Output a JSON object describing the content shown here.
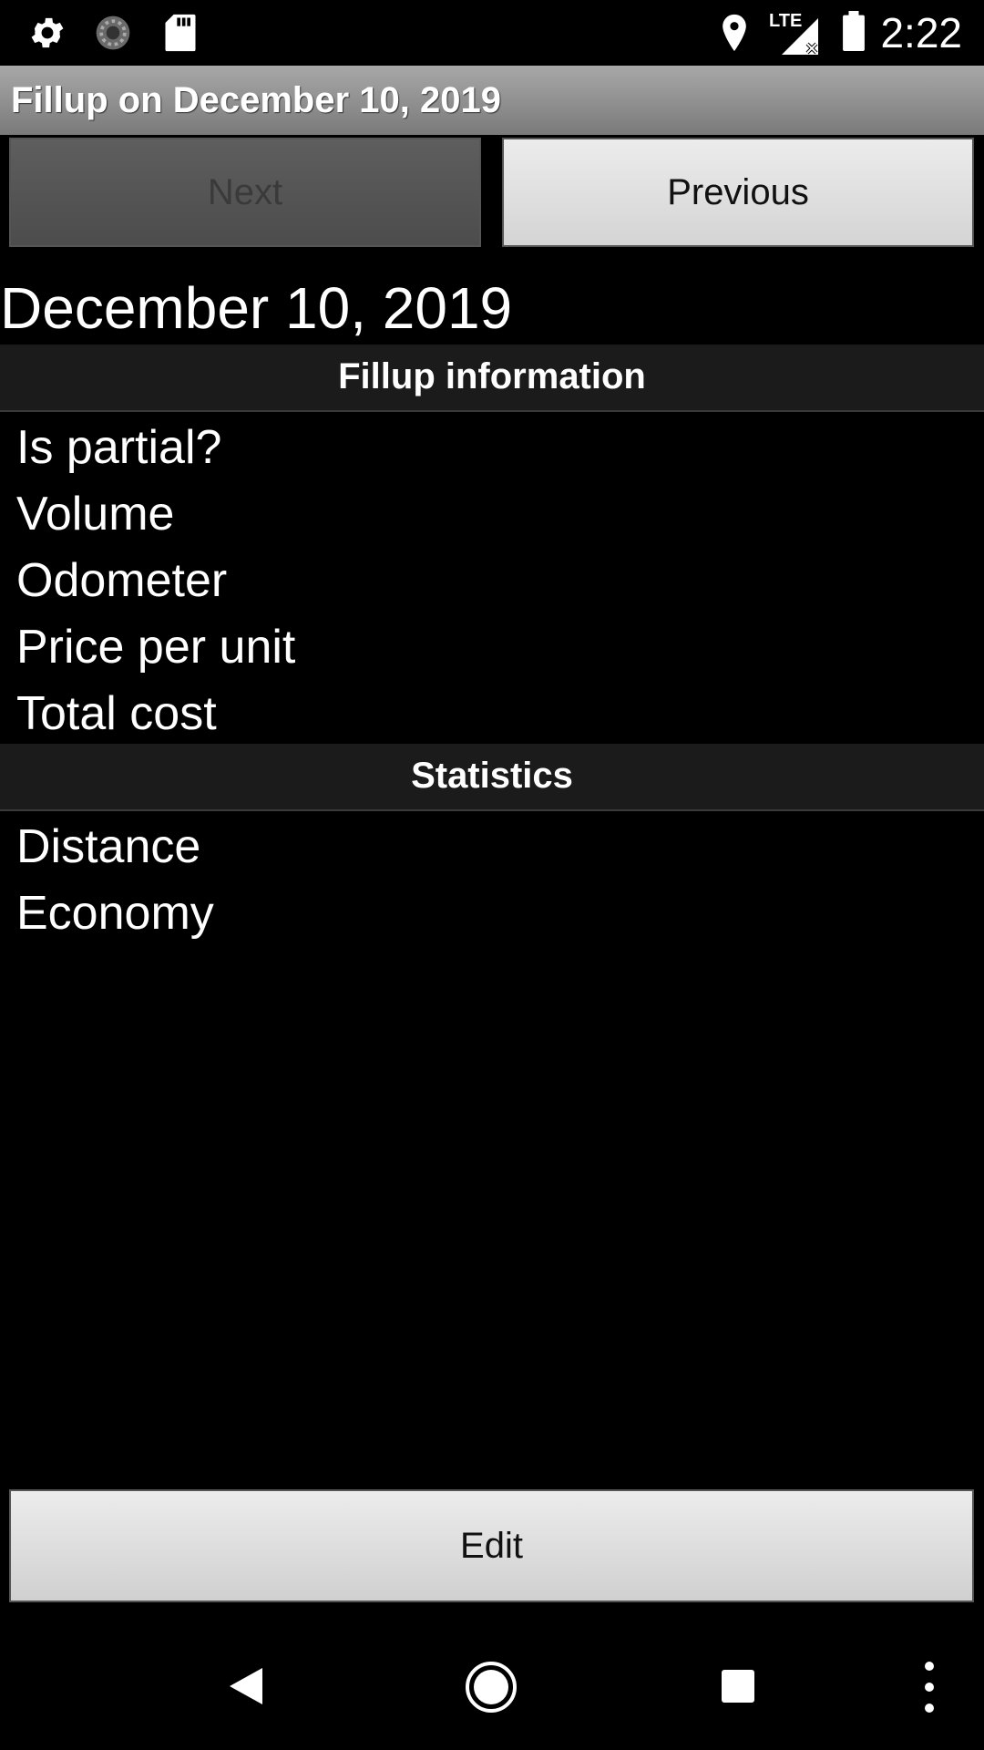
{
  "status_bar": {
    "time": "2:22",
    "left_icons": [
      "settings-icon",
      "sync-icon",
      "sd-card-icon"
    ],
    "right_icons": [
      "location-icon",
      "lte-signal-icon",
      "battery-icon"
    ],
    "network_label": "LTE"
  },
  "title_bar": {
    "title": "Fillup on December 10, 2019"
  },
  "nav_buttons": {
    "next_label": "Next",
    "previous_label": "Previous"
  },
  "date_heading": "December 10, 2019",
  "fillup_section": {
    "header": "Fillup information",
    "rows": [
      "Is partial?",
      "Volume",
      "Odometer",
      "Price per unit",
      "Total cost"
    ]
  },
  "statistics_section": {
    "header": "Statistics",
    "rows": [
      "Distance",
      "Economy"
    ]
  },
  "edit_button_label": "Edit",
  "navigation_bar": {
    "icons": [
      "back-icon",
      "home-icon",
      "recents-icon",
      "overflow-menu-icon"
    ]
  }
}
